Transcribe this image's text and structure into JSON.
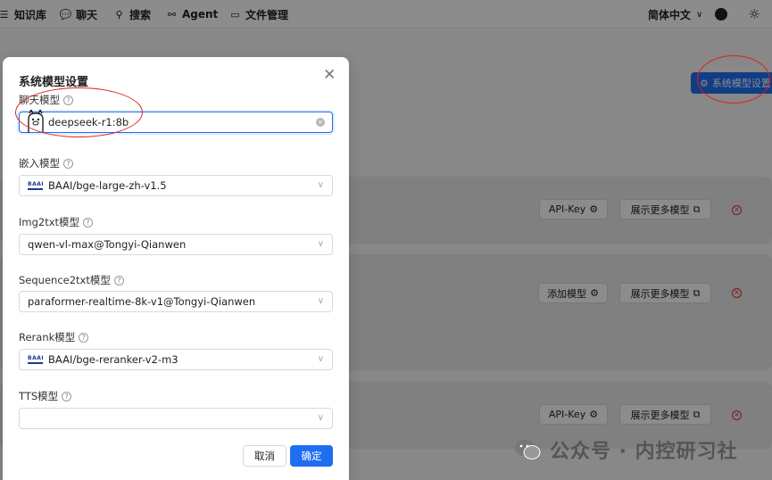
{
  "topbar": {
    "nav": [
      {
        "label": "知识库",
        "icon": "database-icon"
      },
      {
        "label": "聊天",
        "icon": "chat-icon"
      },
      {
        "label": "搜索",
        "icon": "search-icon"
      },
      {
        "label": "Agent",
        "icon": "agent-icon"
      },
      {
        "label": "文件管理",
        "icon": "folder-icon"
      }
    ],
    "language": "简体中文",
    "github_icon": "github-icon",
    "theme_icon": "sun-icon"
  },
  "page": {
    "system_settings_button": "系统模型设置",
    "providers": [
      {
        "buttons": [
          "API-Key",
          "展示更多模型"
        ]
      },
      {
        "buttons": [
          "添加模型",
          "展示更多模型"
        ]
      },
      {
        "buttons": [
          "API-Key",
          "展示更多模型"
        ]
      }
    ]
  },
  "modal": {
    "title": "系统模型设置",
    "fields": [
      {
        "label": "聊天模型",
        "value": "deepseek-r1:8b",
        "icon": "llama-icon"
      },
      {
        "label": "嵌入模型",
        "value": "BAAI/bge-large-zh-v1.5",
        "icon": "baai-logo"
      },
      {
        "label": "Img2txt模型",
        "value": "qwen-vl-max@Tongyi-Qianwen"
      },
      {
        "label": "Sequence2txt模型",
        "value": "paraformer-realtime-8k-v1@Tongyi-Qianwen"
      },
      {
        "label": "Rerank模型",
        "value": "BAAI/bge-reranker-v2-m3",
        "icon": "baai-logo"
      },
      {
        "label": "TTS模型",
        "value": ""
      }
    ],
    "cancel_label": "取消",
    "ok_label": "确定"
  },
  "watermark": {
    "text": "公众号 · 内控研习社"
  },
  "colors": {
    "primary": "#1e6ff0",
    "annotation": "#e02020",
    "danger": "#e0312b"
  }
}
